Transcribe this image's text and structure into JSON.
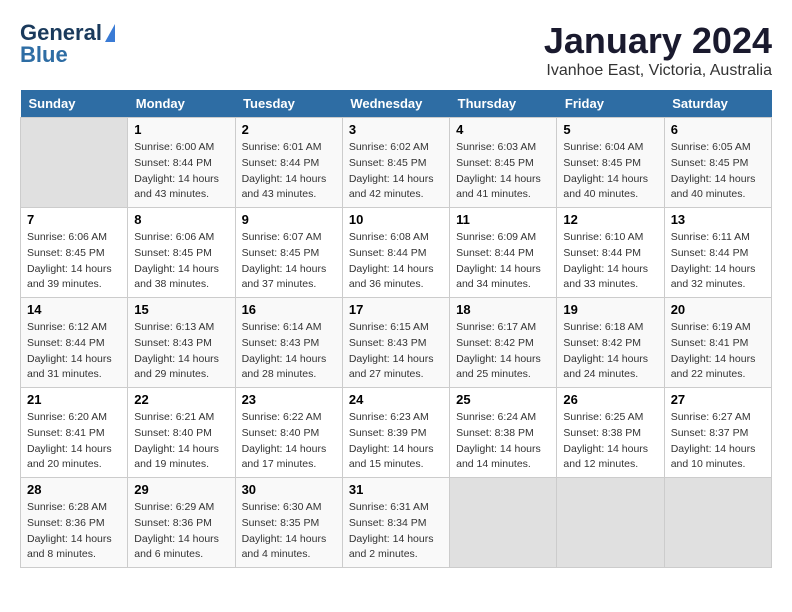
{
  "header": {
    "logo_line1": "General",
    "logo_line2": "Blue",
    "main_title": "January 2024",
    "subtitle": "Ivanhoe East, Victoria, Australia"
  },
  "calendar": {
    "days_of_week": [
      "Sunday",
      "Monday",
      "Tuesday",
      "Wednesday",
      "Thursday",
      "Friday",
      "Saturday"
    ],
    "weeks": [
      [
        {
          "day": "",
          "info": ""
        },
        {
          "day": "1",
          "info": "Sunrise: 6:00 AM\nSunset: 8:44 PM\nDaylight: 14 hours\nand 43 minutes."
        },
        {
          "day": "2",
          "info": "Sunrise: 6:01 AM\nSunset: 8:44 PM\nDaylight: 14 hours\nand 43 minutes."
        },
        {
          "day": "3",
          "info": "Sunrise: 6:02 AM\nSunset: 8:45 PM\nDaylight: 14 hours\nand 42 minutes."
        },
        {
          "day": "4",
          "info": "Sunrise: 6:03 AM\nSunset: 8:45 PM\nDaylight: 14 hours\nand 41 minutes."
        },
        {
          "day": "5",
          "info": "Sunrise: 6:04 AM\nSunset: 8:45 PM\nDaylight: 14 hours\nand 40 minutes."
        },
        {
          "day": "6",
          "info": "Sunrise: 6:05 AM\nSunset: 8:45 PM\nDaylight: 14 hours\nand 40 minutes."
        }
      ],
      [
        {
          "day": "7",
          "info": "Sunrise: 6:06 AM\nSunset: 8:45 PM\nDaylight: 14 hours\nand 39 minutes."
        },
        {
          "day": "8",
          "info": "Sunrise: 6:06 AM\nSunset: 8:45 PM\nDaylight: 14 hours\nand 38 minutes."
        },
        {
          "day": "9",
          "info": "Sunrise: 6:07 AM\nSunset: 8:45 PM\nDaylight: 14 hours\nand 37 minutes."
        },
        {
          "day": "10",
          "info": "Sunrise: 6:08 AM\nSunset: 8:44 PM\nDaylight: 14 hours\nand 36 minutes."
        },
        {
          "day": "11",
          "info": "Sunrise: 6:09 AM\nSunset: 8:44 PM\nDaylight: 14 hours\nand 34 minutes."
        },
        {
          "day": "12",
          "info": "Sunrise: 6:10 AM\nSunset: 8:44 PM\nDaylight: 14 hours\nand 33 minutes."
        },
        {
          "day": "13",
          "info": "Sunrise: 6:11 AM\nSunset: 8:44 PM\nDaylight: 14 hours\nand 32 minutes."
        }
      ],
      [
        {
          "day": "14",
          "info": "Sunrise: 6:12 AM\nSunset: 8:44 PM\nDaylight: 14 hours\nand 31 minutes."
        },
        {
          "day": "15",
          "info": "Sunrise: 6:13 AM\nSunset: 8:43 PM\nDaylight: 14 hours\nand 29 minutes."
        },
        {
          "day": "16",
          "info": "Sunrise: 6:14 AM\nSunset: 8:43 PM\nDaylight: 14 hours\nand 28 minutes."
        },
        {
          "day": "17",
          "info": "Sunrise: 6:15 AM\nSunset: 8:43 PM\nDaylight: 14 hours\nand 27 minutes."
        },
        {
          "day": "18",
          "info": "Sunrise: 6:17 AM\nSunset: 8:42 PM\nDaylight: 14 hours\nand 25 minutes."
        },
        {
          "day": "19",
          "info": "Sunrise: 6:18 AM\nSunset: 8:42 PM\nDaylight: 14 hours\nand 24 minutes."
        },
        {
          "day": "20",
          "info": "Sunrise: 6:19 AM\nSunset: 8:41 PM\nDaylight: 14 hours\nand 22 minutes."
        }
      ],
      [
        {
          "day": "21",
          "info": "Sunrise: 6:20 AM\nSunset: 8:41 PM\nDaylight: 14 hours\nand 20 minutes."
        },
        {
          "day": "22",
          "info": "Sunrise: 6:21 AM\nSunset: 8:40 PM\nDaylight: 14 hours\nand 19 minutes."
        },
        {
          "day": "23",
          "info": "Sunrise: 6:22 AM\nSunset: 8:40 PM\nDaylight: 14 hours\nand 17 minutes."
        },
        {
          "day": "24",
          "info": "Sunrise: 6:23 AM\nSunset: 8:39 PM\nDaylight: 14 hours\nand 15 minutes."
        },
        {
          "day": "25",
          "info": "Sunrise: 6:24 AM\nSunset: 8:38 PM\nDaylight: 14 hours\nand 14 minutes."
        },
        {
          "day": "26",
          "info": "Sunrise: 6:25 AM\nSunset: 8:38 PM\nDaylight: 14 hours\nand 12 minutes."
        },
        {
          "day": "27",
          "info": "Sunrise: 6:27 AM\nSunset: 8:37 PM\nDaylight: 14 hours\nand 10 minutes."
        }
      ],
      [
        {
          "day": "28",
          "info": "Sunrise: 6:28 AM\nSunset: 8:36 PM\nDaylight: 14 hours\nand 8 minutes."
        },
        {
          "day": "29",
          "info": "Sunrise: 6:29 AM\nSunset: 8:36 PM\nDaylight: 14 hours\nand 6 minutes."
        },
        {
          "day": "30",
          "info": "Sunrise: 6:30 AM\nSunset: 8:35 PM\nDaylight: 14 hours\nand 4 minutes."
        },
        {
          "day": "31",
          "info": "Sunrise: 6:31 AM\nSunset: 8:34 PM\nDaylight: 14 hours\nand 2 minutes."
        },
        {
          "day": "",
          "info": ""
        },
        {
          "day": "",
          "info": ""
        },
        {
          "day": "",
          "info": ""
        }
      ]
    ]
  }
}
